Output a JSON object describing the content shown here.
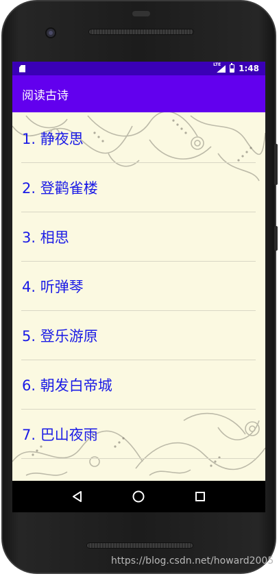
{
  "status_bar": {
    "lte_label": "LTE",
    "time": "1:48"
  },
  "app_bar": {
    "title": "阅读古诗"
  },
  "poems": [
    {
      "label": "1. 静夜思"
    },
    {
      "label": "2. 登鹳雀楼"
    },
    {
      "label": "3. 相思"
    },
    {
      "label": "4. 听弹琴"
    },
    {
      "label": "5. 登乐游原"
    },
    {
      "label": "6. 朝发白帝城"
    },
    {
      "label": "7. 巴山夜雨"
    }
  ],
  "navigation": {
    "back_icon": "back-triangle-icon",
    "home_icon": "home-circle-icon",
    "recents_icon": "recents-square-icon"
  },
  "watermark": "https://blog.csdn.net/howard2005",
  "colors": {
    "status_bar": "#3a00b6",
    "app_bar": "#6200ee",
    "list_text": "#1a1ae6",
    "background": "#fbf9e1"
  }
}
